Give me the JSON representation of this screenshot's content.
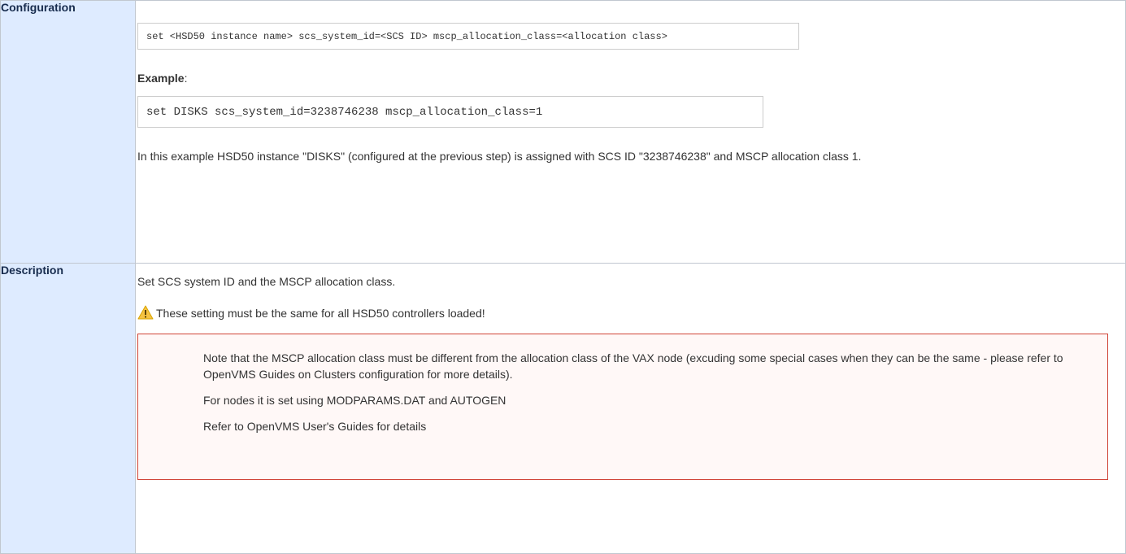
{
  "configuration": {
    "header": "Configuration",
    "code_syntax": "set <HSD50 instance name> scs_system_id=<SCS ID> mscp_allocation_class=<allocation class>",
    "example_label": "Example",
    "example_colon": ":",
    "code_example": "set DISKS scs_system_id=3238746238 mscp_allocation_class=1",
    "example_text": "In this example HSD50 instance \"DISKS\" (configured at the previous step) is assigned with SCS ID \"3238746238\" and MSCP allocation class 1."
  },
  "description": {
    "header": "Description",
    "summary": "Set SCS system ID and the MSCP allocation class.",
    "warning_icon": "warning-icon",
    "warning_text": "These setting must be the same for all HSD50 controllers loaded!",
    "note": {
      "border_color": "#d04437",
      "background": "#fff8f7",
      "paragraphs": [
        "Note that the MSCP allocation class must be different from the allocation class of the VAX node (excuding some special cases when they can be the same - please refer to OpenVMS Guides on Clusters configuration for more details).",
        "For nodes it is set using MODPARAMS.DAT and AUTOGEN",
        "Refer to OpenVMS User's Guides for details"
      ]
    }
  },
  "colors": {
    "header_bg": "#deebff",
    "header_text": "#172b4d",
    "warning_fill": "#f6c342"
  }
}
